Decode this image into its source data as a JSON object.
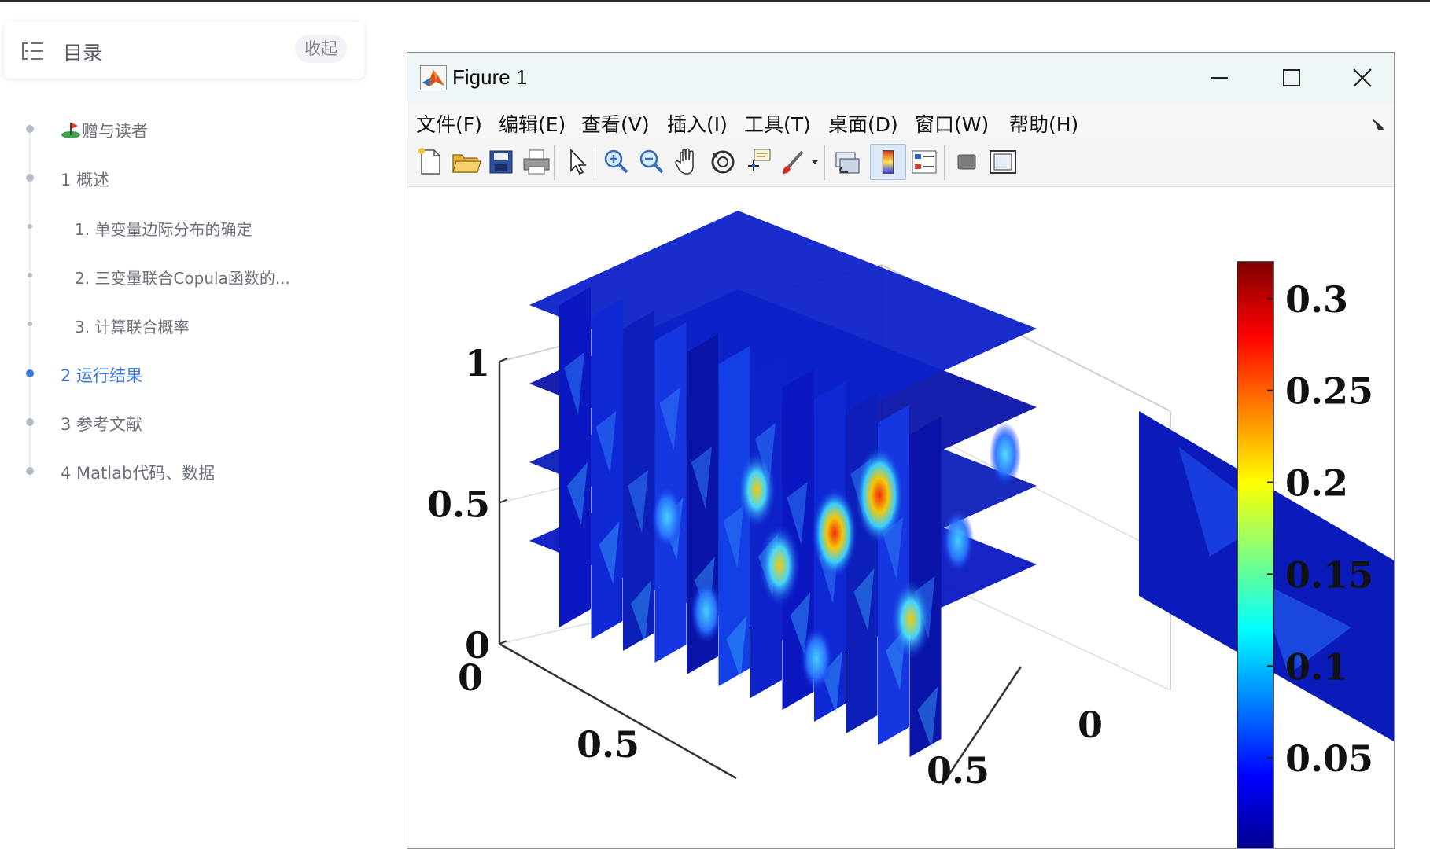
{
  "toc": {
    "title": "目录",
    "collapse_label": "收起",
    "items": [
      {
        "label": "赠与读者",
        "icon": "golf-flag-icon",
        "level": 1
      },
      {
        "label": "1 概述",
        "level": 1
      },
      {
        "label": "1. 单变量边际分布的确定",
        "level": 2
      },
      {
        "label": "2. 三变量联合Copula函数的...",
        "level": 2
      },
      {
        "label": "3. 计算联合概率",
        "level": 2
      },
      {
        "label": "2 运行结果",
        "level": 1,
        "active": true
      },
      {
        "label": "3 参考文献",
        "level": 1
      },
      {
        "label": "4 Matlab代码、数据",
        "level": 1
      }
    ]
  },
  "window": {
    "title": "Figure 1",
    "controls": [
      "minimize-icon",
      "maximize-icon",
      "close-icon"
    ],
    "menu": [
      "文件(F)",
      "编辑(E)",
      "查看(V)",
      "插入(I)",
      "工具(T)",
      "桌面(D)",
      "窗口(W)",
      "帮助(H)"
    ],
    "toolbar": [
      "new-figure-icon",
      "open-file-icon",
      "save-icon",
      "print-icon",
      "pointer-icon",
      "zoom-in-icon",
      "zoom-out-icon",
      "pan-icon",
      "rotate-3d-icon",
      "data-cursor-icon",
      "brush-icon",
      "link-plot-icon",
      "colorbar-icon",
      "legend-icon",
      "hide-plot-tools-icon",
      "show-plot-tools-icon"
    ],
    "pressed_toolbar": "colorbar-icon"
  },
  "chart_data": {
    "type": "heatmap",
    "subtype": "3d-slice",
    "z_ticks": [
      "0",
      "0.5",
      "1"
    ],
    "x_ticks": [
      "0",
      "0.5"
    ],
    "y_ticks": [
      "0",
      "0.5"
    ],
    "zlim": [
      0,
      1
    ],
    "colormap": "jet",
    "colorbar": {
      "ticks": [
        "0.05",
        "0.1",
        "0.15",
        "0.2",
        "0.25",
        "0.3"
      ],
      "range": [
        0,
        0.32
      ],
      "placement": "right"
    },
    "grid": true,
    "slice_count_x": 12,
    "slice_count_z": 4,
    "hotspots": [
      0.31,
      0.27,
      0.23,
      0.22,
      0.2
    ]
  },
  "colors": {
    "toc_active": "#3a78d8",
    "toc_text": "#6b707a",
    "titlebar": "#eef6f8",
    "slice_base": "#0d1ec8"
  }
}
